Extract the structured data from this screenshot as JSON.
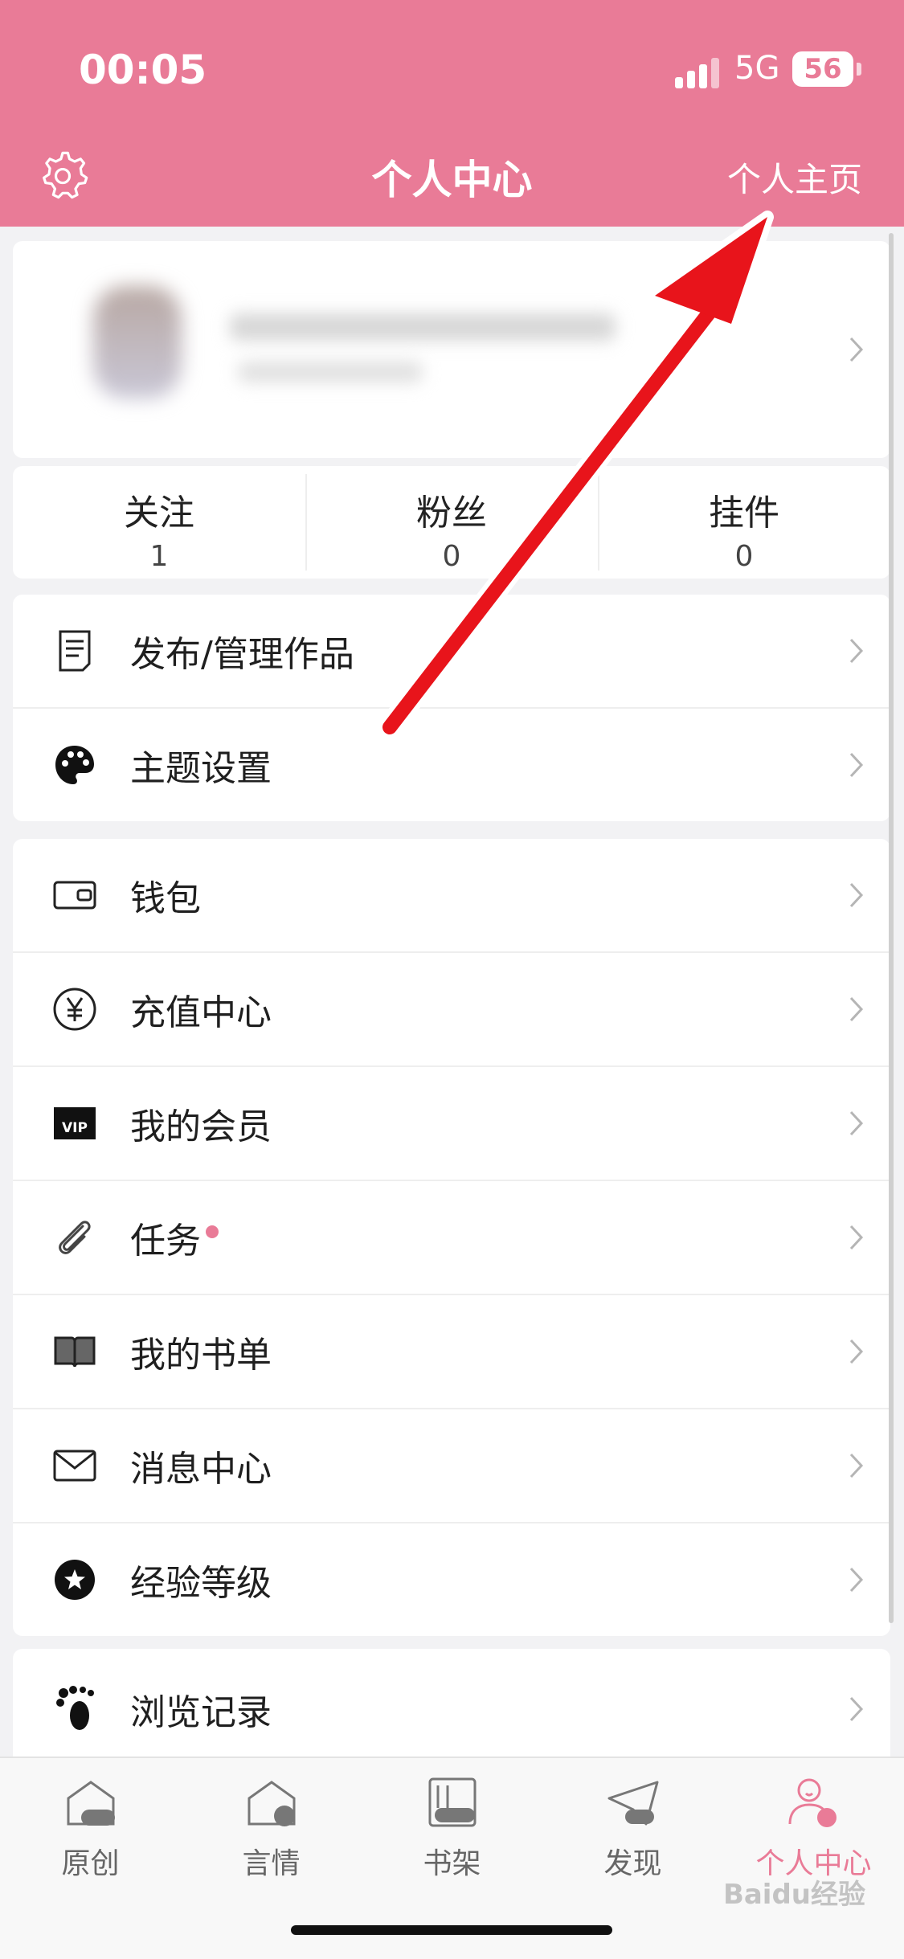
{
  "status": {
    "time": "00:05",
    "network": "5G",
    "battery": "56"
  },
  "header": {
    "title": "个人中心",
    "home_link": "个人主页"
  },
  "stats": [
    {
      "label": "关注",
      "value": "1"
    },
    {
      "label": "粉丝",
      "value": "0"
    },
    {
      "label": "挂件",
      "value": "0"
    }
  ],
  "groups": [
    [
      {
        "label": "发布/管理作品",
        "icon": "document-icon"
      },
      {
        "label": "主题设置",
        "icon": "palette-icon"
      }
    ],
    [
      {
        "label": "钱包",
        "icon": "wallet-icon"
      },
      {
        "label": "充值中心",
        "icon": "yuan-icon"
      },
      {
        "label": "我的会员",
        "icon": "vip-icon",
        "icon_text": "VIP"
      },
      {
        "label": "任务",
        "icon": "paperclip-icon",
        "badge": true
      },
      {
        "label": "我的书单",
        "icon": "book-icon"
      },
      {
        "label": "消息中心",
        "icon": "mail-icon"
      },
      {
        "label": "经验等级",
        "icon": "star-badge-icon"
      }
    ],
    [
      {
        "label": "浏览记录",
        "icon": "footprint-icon"
      }
    ]
  ],
  "tabs": [
    {
      "label": "原创",
      "icon": "original-icon"
    },
    {
      "label": "言情",
      "icon": "romance-icon"
    },
    {
      "label": "书架",
      "icon": "bookshelf-icon"
    },
    {
      "label": "发现",
      "icon": "discover-icon"
    },
    {
      "label": "个人中心",
      "icon": "profile-icon",
      "active": true
    }
  ],
  "colors": {
    "accent": "#e97b97",
    "arrow": "#e8141b"
  },
  "watermark": "Baidu经验"
}
